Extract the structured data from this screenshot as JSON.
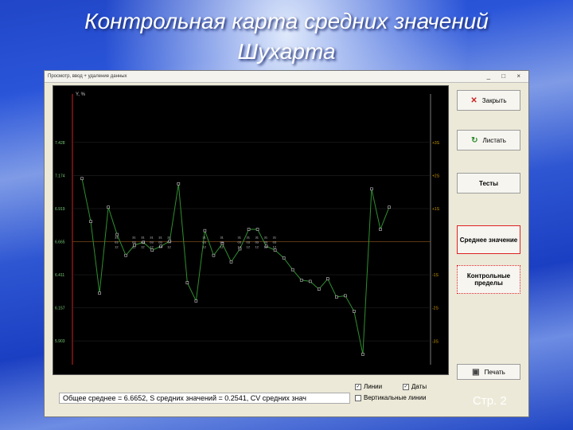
{
  "slide": {
    "title_line1": "Контрольная карта средних значений",
    "title_line2": "Шухарта",
    "page_label": "Стр. 2"
  },
  "window": {
    "title": "Просмотр, ввод + удаление данных",
    "controls": [
      "_",
      "□",
      "×"
    ]
  },
  "chart_data": {
    "type": "line",
    "ylabel": "Y, %",
    "y_ticks": [
      7.428,
      7.174,
      6.919,
      6.665,
      6.411,
      6.157,
      5.903
    ],
    "right_labels": [
      "+3S",
      "+2S",
      "+1S",
      "-1S",
      "-2S",
      "-3S"
    ],
    "center_line": 6.665,
    "ylim": [
      5.72,
      7.8
    ],
    "series": [
      {
        "values": [
          7.15,
          6.82,
          6.27,
          6.93,
          6.72,
          6.56,
          6.64,
          6.66,
          6.6,
          6.63,
          6.67,
          7.11,
          6.35,
          6.21,
          6.75,
          6.56,
          6.65,
          6.51,
          6.61,
          6.76,
          6.76,
          6.63,
          6.6,
          6.54,
          6.45,
          6.37,
          6.36,
          6.3,
          6.38,
          6.24,
          6.25,
          6.13,
          5.8,
          7.07,
          6.76,
          6.93
        ],
        "color": "#2f8f2f"
      }
    ],
    "point_labels": [
      "31",
      "03",
      "12"
    ],
    "grid": false
  },
  "buttons": {
    "close": "Закрыть",
    "page": "Листать",
    "tests": "Тесты",
    "mean": "Среднее значение",
    "limits": "Контрольные пределы",
    "print": "Печать"
  },
  "stats_text": "Общее среднее = 6.6652,  S средних значений = 0.2541,  CV средних знач",
  "options": {
    "lines": "Линии",
    "dates": "Даты",
    "vertical": "Вертикальные линии"
  }
}
